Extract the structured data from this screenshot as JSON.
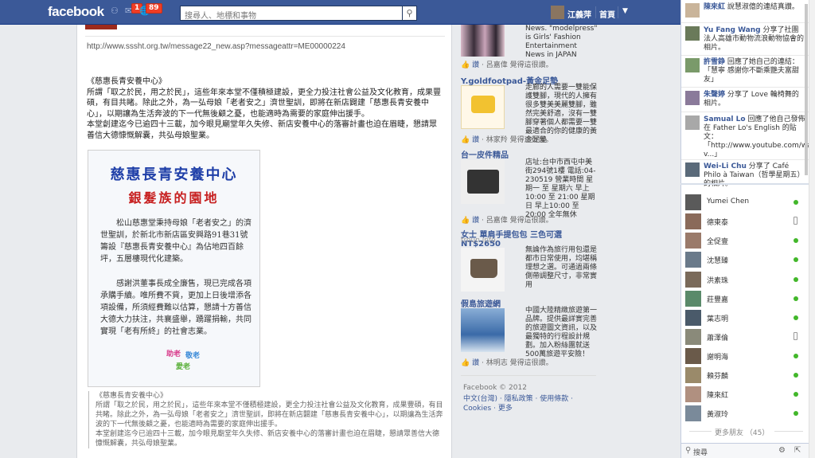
{
  "topbar": {
    "logo": "facebook",
    "friend_requests_badge": "",
    "messages_badge": "1",
    "notifications_badge": "89",
    "search_placeholder": "搜尋人、地標和事物",
    "user_name": "江義萍",
    "home": "首頁"
  },
  "post": {
    "link": "http://www.sssht.org.tw/message22_new.asp?messageattr=ME00000224",
    "body": [
      "《慈惠長青安養中心》",
      "所謂「取之於民，用之於民」，這些年來本堂不僅積極建設，更全力投注社會公益及文化教育，成果豐碩，有目共睹。除此之外，為一弘母娘「老者安之」濟世聖訓，即將在新店闢建「慈惠長青安養中心」，以期讓為生活奔波的下一代無後顧之憂，也能適時為需要的家庭伸出援手。",
      "本堂創建迄今已逾四十三載，加今眼見廟堂年久失修、新店安養中心的落審計畫也迫在眉睫，懇請眾善信大德慷慨解囊，共弘母娘聖業。"
    ],
    "poster": {
      "title": "慈惠長青安養中心",
      "subtitle": "銀髮族的園地",
      "p1": "松山慈惠堂秉持母娘「老者安之」的濟世聖訓，於新北市新店區安興路91巷31號籌設『慈惠長青安養中心』為佔地四百餘坪，五層樓現代化建築。",
      "p2": "感謝洪董事長成全廉售，現已完成各項承購手續。唯所費不貲，更加上日後增添各項設備，所須經費難以估算，懇請十方善信大德大力扶注，共襄盛舉，踴躍捐輸，共同實現「老有所終」的社會志業。",
      "logo_1": "助老",
      "logo_2": "敬老",
      "logo_3": "愛老"
    },
    "quote": [
      "《慈惠長青安養中心》",
      "所謂「取之於民，用之於民」，這些年來本堂不僅積極建設，更全力投注社會公益及文化教育，成果豐碩，有目共睹。除此之外，為一弘母娘「老者安之」濟世聖訓，即將在新店闢建「慈惠長青安養中心」，以期讓為生活奔波的下一代無後顧之憂，也能適時為需要的家庭伸出援手。",
      "本堂創建迄今已逾四十三載，加今眼見廟堂年久失修、新店安養中心的落審計畫也迫在眉睫，懇請眾善信大德慷慨解囊，共弘母娘聖業。"
    ]
  },
  "ads": [
    {
      "title": "",
      "url": "",
      "text": "News. \"modelpress\" is Girls' Fashion Entertainment News in JAPAN",
      "like_action": "讚",
      "like_user": "呂嘉偉",
      "like_suffix": "覺得這很讚。"
    },
    {
      "title": "Y.goldfootpad-黃金足墊",
      "url": "",
      "text": "走廊的人需要一雙能保護雙腳，現代的人擁有很多雙美美麗雙腳，雖然完美舒適，沒有一雙腳穿著個人都需要一雙最適合的你的健康的黃金足墊",
      "like_action": "讚",
      "like_user": "林家羚",
      "like_suffix": "覺得這很讚。"
    },
    {
      "title": "台一皮件精品",
      "url": "",
      "text": "店址:台中市西屯中美街294號1樓 電話:04-230519 營業時間 星期一 至 星期六 早上10:00 至 21:00 星期日 早上10:00 至 20:00 全年無休",
      "like_action": "讚",
      "like_user": "呂嘉偉",
      "like_suffix": "覺得這很讚。"
    },
    {
      "title": "女士 單肩手提包包 三色可選 NT$2650",
      "url": "troun.info",
      "text": "無論作為旅行用包還是都市日常使用，均堪稱理想之選。可通過兩條側帶調整尺寸，非常實用",
      "like_action": "",
      "like_user": "",
      "like_suffix": ""
    },
    {
      "title": "假島旅遊網",
      "url": "",
      "text": "中國大陸精緻旅遊第一品牌。提供最詳實完善的旅遊圖文資訊，以及最獨特的行程設計規劃。加入粉絲團就送500萬旅遊平安險！",
      "like_action": "讚",
      "like_user": "林明志",
      "like_suffix": "覺得這很讚。"
    }
  ],
  "footer": {
    "copyright": "Facebook © 2012",
    "links": "中文(台灣) · 隱私政策 · 使用條款 · Cookies · 更多"
  },
  "ticker": [
    {
      "name": "陳來紅",
      "text": "說慧淑億的連結真讚。"
    },
    {
      "name": "Yu Fang Wang",
      "text": "分享了社團法人高雄市動物流浪動物協會的相片。"
    },
    {
      "name": "許雪錚",
      "text": "回應了她自己的連結：「慧寧 感謝你不斷乘艷夫富甜友」"
    },
    {
      "name": "朱聲婷",
      "text": "分享了 Love 輪椅舞的相片。"
    },
    {
      "name": "Samual Lo",
      "text": "回應了他自己發佈在 Father Lo's English 的貼文：「http://www.youtube.com/watch?v...」"
    },
    {
      "name": "Wei-Li Chu",
      "text": "分享了 Café Philo à Taiwan（哲學星期五）的相片。"
    }
  ],
  "friends": [
    {
      "name": "Yumei Chen",
      "status": "online"
    },
    {
      "name": "德東泰",
      "status": "mobile"
    },
    {
      "name": "全促壹",
      "status": "online"
    },
    {
      "name": "沈慧臻",
      "status": "online"
    },
    {
      "name": "洪素珠",
      "status": "online"
    },
    {
      "name": "莊豐嘉",
      "status": "online"
    },
    {
      "name": "葉志明",
      "status": "online"
    },
    {
      "name": "蕭澤倫",
      "status": "mobile"
    },
    {
      "name": "謝明海",
      "status": "online"
    },
    {
      "name": "賴芬麟",
      "status": "online"
    },
    {
      "name": "陳來紅",
      "status": "online"
    },
    {
      "name": "黃淑玲",
      "status": "online"
    }
  ],
  "chat": {
    "more_friends": "更多朋友 （45）",
    "search_placeholder": "搜尋"
  },
  "colors": {
    "brand": "#3b5998",
    "online": "#42b72a",
    "badge": "#f03d25"
  }
}
